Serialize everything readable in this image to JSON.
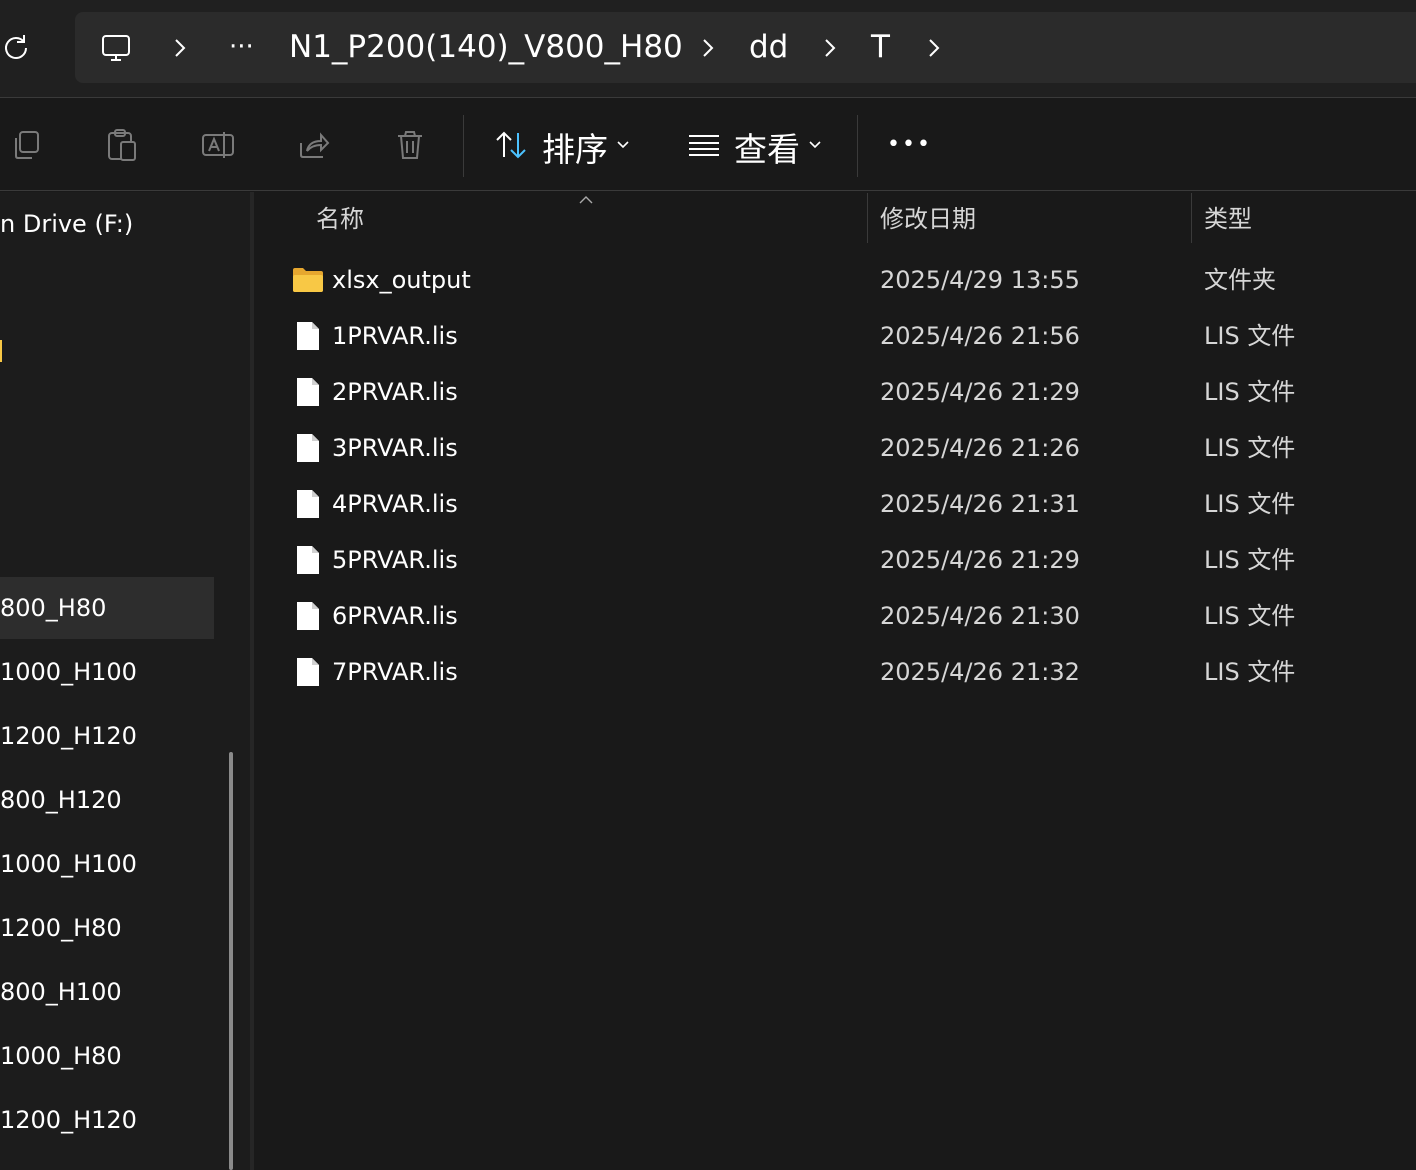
{
  "breadcrumb": {
    "overflow_label": "···",
    "items": [
      {
        "label": "N1_P200(140)_V800_H80"
      },
      {
        "label": "dd"
      },
      {
        "label": "T"
      }
    ]
  },
  "toolbar": {
    "sort_label": "排序",
    "view_label": "查看",
    "more_label": "•••"
  },
  "sidebar": {
    "drive_label": "n Drive (F:)",
    "items": [
      {
        "label": "800_H80"
      },
      {
        "label": "1000_H100"
      },
      {
        "label": "1200_H120"
      },
      {
        "label": "800_H120"
      },
      {
        "label": "1000_H100"
      },
      {
        "label": "1200_H80"
      },
      {
        "label": "800_H100"
      },
      {
        "label": "1000_H80"
      },
      {
        "label": "1200_H120"
      }
    ]
  },
  "columns": {
    "name": "名称",
    "modified": "修改日期",
    "type": "类型"
  },
  "files": [
    {
      "name": "xlsx_output",
      "modified": "2025/4/29 13:55",
      "type": "文件夹",
      "icon": "folder-icon"
    },
    {
      "name": "1PRVAR.lis",
      "modified": "2025/4/26 21:56",
      "type": "LIS 文件",
      "icon": "file-icon"
    },
    {
      "name": "2PRVAR.lis",
      "modified": "2025/4/26 21:29",
      "type": "LIS 文件",
      "icon": "file-icon"
    },
    {
      "name": "3PRVAR.lis",
      "modified": "2025/4/26 21:26",
      "type": "LIS 文件",
      "icon": "file-icon"
    },
    {
      "name": "4PRVAR.lis",
      "modified": "2025/4/26 21:31",
      "type": "LIS 文件",
      "icon": "file-icon"
    },
    {
      "name": "5PRVAR.lis",
      "modified": "2025/4/26 21:29",
      "type": "LIS 文件",
      "icon": "file-icon"
    },
    {
      "name": "6PRVAR.lis",
      "modified": "2025/4/26 21:30",
      "type": "LIS 文件",
      "icon": "file-icon"
    },
    {
      "name": "7PRVAR.lis",
      "modified": "2025/4/26 21:32",
      "type": "LIS 文件",
      "icon": "file-icon"
    }
  ],
  "colors": {
    "background": "#191919",
    "address_bar": "#2b2b2b",
    "folder_yellow": "#f8c845",
    "sort_accent": "#4cc2ff",
    "selected_item": "#2d2d2d"
  }
}
